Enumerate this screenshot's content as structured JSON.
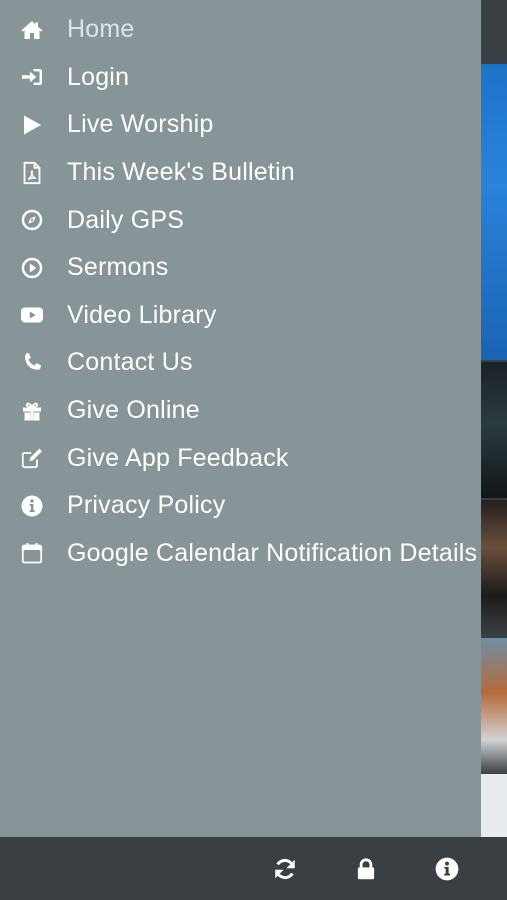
{
  "drawer": {
    "items": [
      {
        "label": "Home",
        "icon": "home-icon",
        "active": true
      },
      {
        "label": "Login",
        "icon": "sign-in-icon"
      },
      {
        "label": "Live Worship",
        "icon": "play-icon"
      },
      {
        "label": "This Week's Bulletin",
        "icon": "pdf-file-icon"
      },
      {
        "label": "Daily GPS",
        "icon": "compass-icon"
      },
      {
        "label": "Sermons",
        "icon": "play-circle-icon"
      },
      {
        "label": "Video Library",
        "icon": "youtube-icon"
      },
      {
        "label": "Contact Us",
        "icon": "phone-icon"
      },
      {
        "label": "Give Online",
        "icon": "gift-icon"
      },
      {
        "label": "Give App Feedback",
        "icon": "edit-icon"
      },
      {
        "label": "Privacy Policy",
        "icon": "info-circle-icon"
      },
      {
        "label": "Google Calendar Notification Details",
        "icon": "calendar-icon"
      }
    ]
  },
  "bottom_bar": {
    "buttons": [
      {
        "icon": "refresh-icon"
      },
      {
        "icon": "lock-icon"
      },
      {
        "icon": "info-icon"
      }
    ]
  },
  "colors": {
    "drawer_bg": "#879599",
    "bar_bg": "#3a3f43",
    "text": "#ffffff"
  }
}
